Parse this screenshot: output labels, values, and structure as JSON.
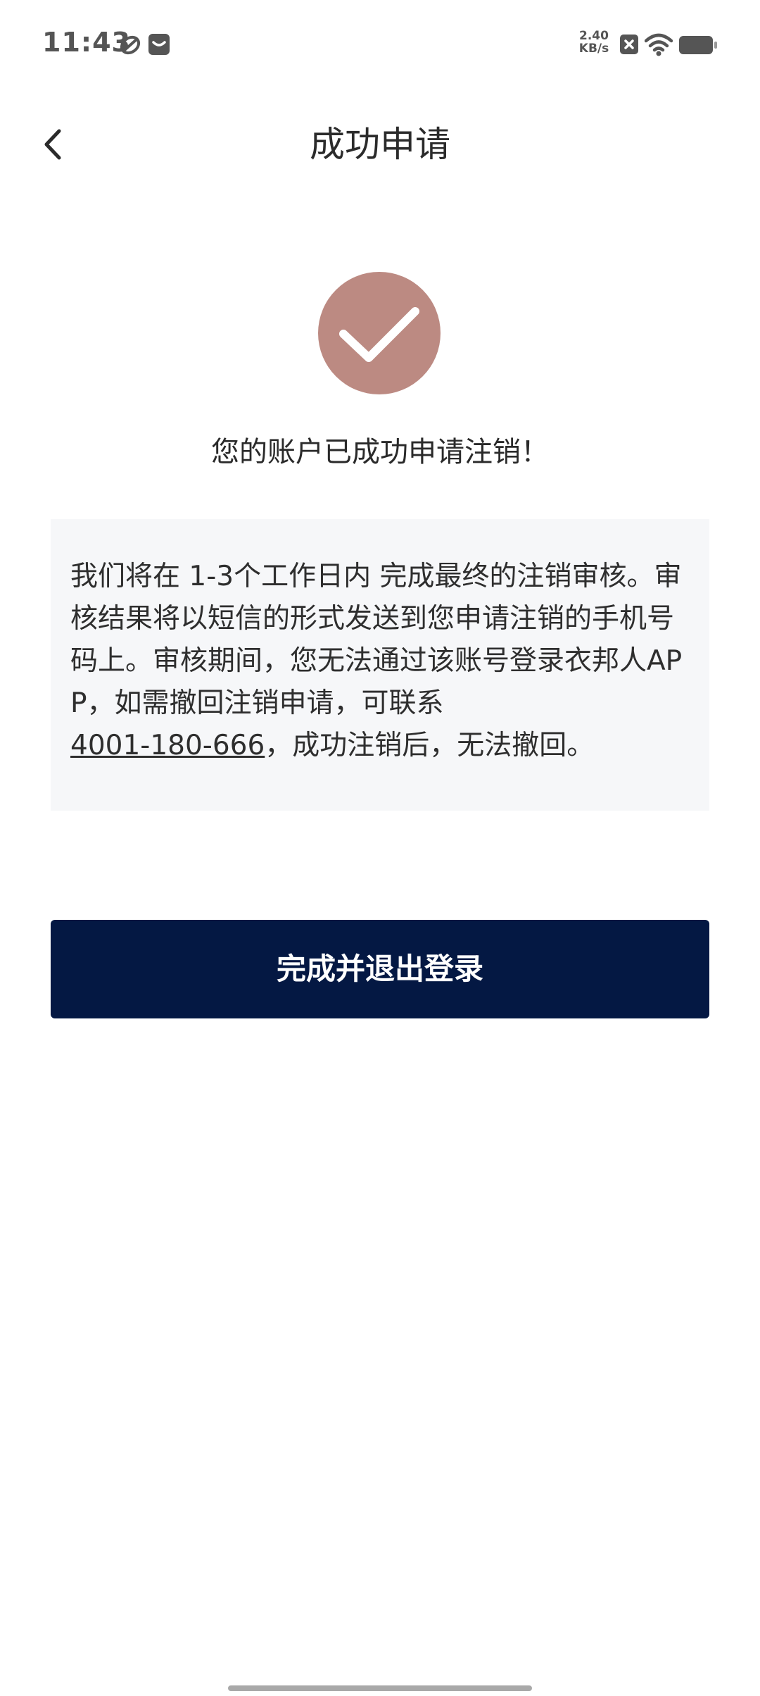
{
  "status_bar": {
    "time": "11:43",
    "network_speed_value": "2.40",
    "network_speed_unit": "KB/s",
    "icons": [
      "sync-icon",
      "message-icon",
      "data-off-icon",
      "wifi-icon",
      "battery-icon"
    ]
  },
  "header": {
    "title": "成功申请",
    "back_icon": "chevron-left-icon"
  },
  "success": {
    "icon": "check-circle-icon",
    "icon_color": "#bc8a82",
    "message": "您的账户已成功申请注销！"
  },
  "info": {
    "text_before_phone": "我们将在 1-3个工作日内 完成最终的注销审核。审核结果将以短信的形式发送到您申请注销的手机号码上。审核期间，您无法通过该账号登录衣邦人APP，如需撤回注销申请，可联系",
    "phone": "4001-180-666",
    "text_after_phone": "，成功注销后，无法撤回。"
  },
  "actions": {
    "primary_label": "完成并退出登录",
    "primary_color": "#041843"
  }
}
